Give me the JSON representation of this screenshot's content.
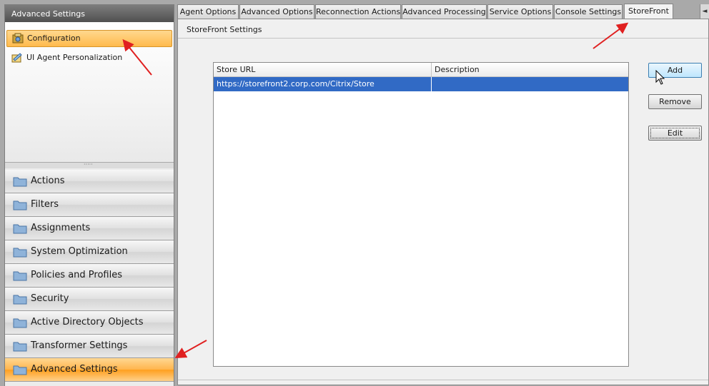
{
  "left_panel": {
    "title": "Advanced Settings",
    "tree_items": [
      {
        "label": "Configuration",
        "icon": "config-icon",
        "selected": true
      },
      {
        "label": "UI Agent Personalization",
        "icon": "personalization-icon",
        "selected": false
      }
    ],
    "nav_items": [
      {
        "label": "Actions",
        "selected": false
      },
      {
        "label": "Filters",
        "selected": false
      },
      {
        "label": "Assignments",
        "selected": false
      },
      {
        "label": "System Optimization",
        "selected": false
      },
      {
        "label": "Policies and Profiles",
        "selected": false
      },
      {
        "label": "Security",
        "selected": false
      },
      {
        "label": "Active Directory Objects",
        "selected": false
      },
      {
        "label": "Transformer Settings",
        "selected": false
      },
      {
        "label": "Advanced Settings",
        "selected": true
      }
    ]
  },
  "tabs": [
    {
      "label": "Agent Options",
      "active": false
    },
    {
      "label": "Advanced Options",
      "active": false
    },
    {
      "label": "Reconnection Actions",
      "active": false
    },
    {
      "label": "Advanced Processing",
      "active": false
    },
    {
      "label": "Service Options",
      "active": false
    },
    {
      "label": "Console Settings",
      "active": false
    },
    {
      "label": "StoreFront",
      "active": true
    }
  ],
  "tab_scroll_glyph": "◄",
  "panel": {
    "title": "StoreFront Settings",
    "table": {
      "columns": [
        "Store URL",
        "Description"
      ],
      "rows": [
        [
          "https://storefront2.corp.com/Citrix/Store",
          ""
        ]
      ],
      "selected_row": 0
    },
    "buttons": {
      "add": "Add",
      "remove": "Remove",
      "edit": "Edit"
    }
  },
  "colors": {
    "selection_orange": "#ffb54d",
    "row_highlight": "#316ac5",
    "annotation_arrow": "#e02020"
  }
}
